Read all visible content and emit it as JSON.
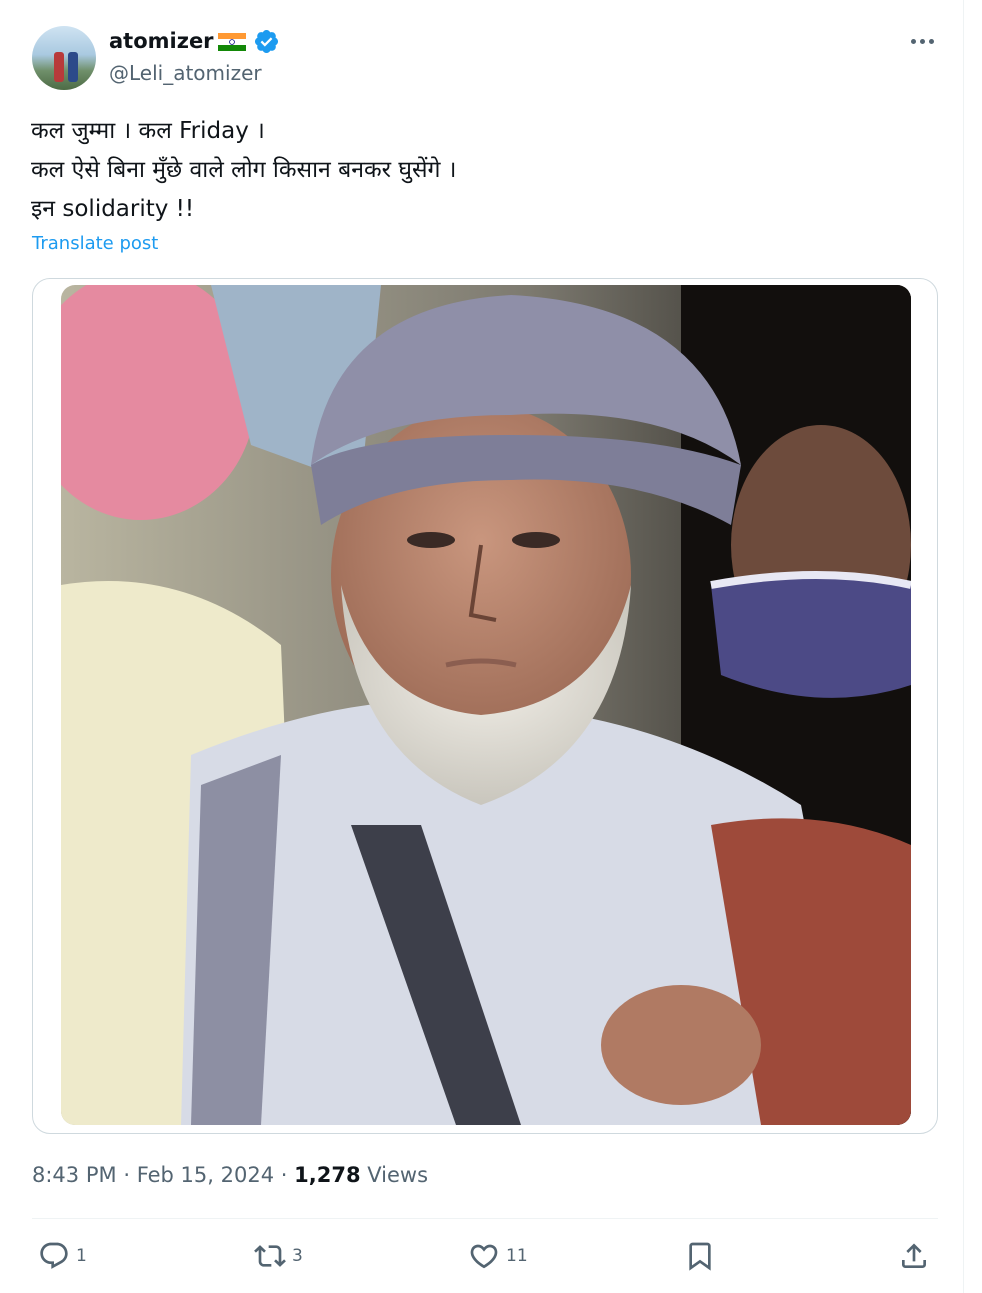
{
  "author": {
    "display_name": "atomizer",
    "handle": "@Leli_atomizer",
    "flag": "india-flag-icon",
    "verified_badge": "verified-icon"
  },
  "post": {
    "lines": [
      "कल जुम्मा । कल Friday ।",
      "कल ऐसे बिना मुँछे वाले लोग किसान बनकर घुसेंगे ।",
      "इन solidarity !!"
    ],
    "translate_label": "Translate post"
  },
  "meta": {
    "time": "8:43 PM",
    "sep1": "·",
    "date": "Feb 15, 2024",
    "sep2": "·",
    "views_count": "1,278",
    "views_label": "Views"
  },
  "actions": {
    "reply_count": "1",
    "repost_count": "3",
    "like_count": "11"
  },
  "colors": {
    "accent": "#1d9bf0",
    "muted_text": "#536471",
    "border": "#cfd9de"
  }
}
